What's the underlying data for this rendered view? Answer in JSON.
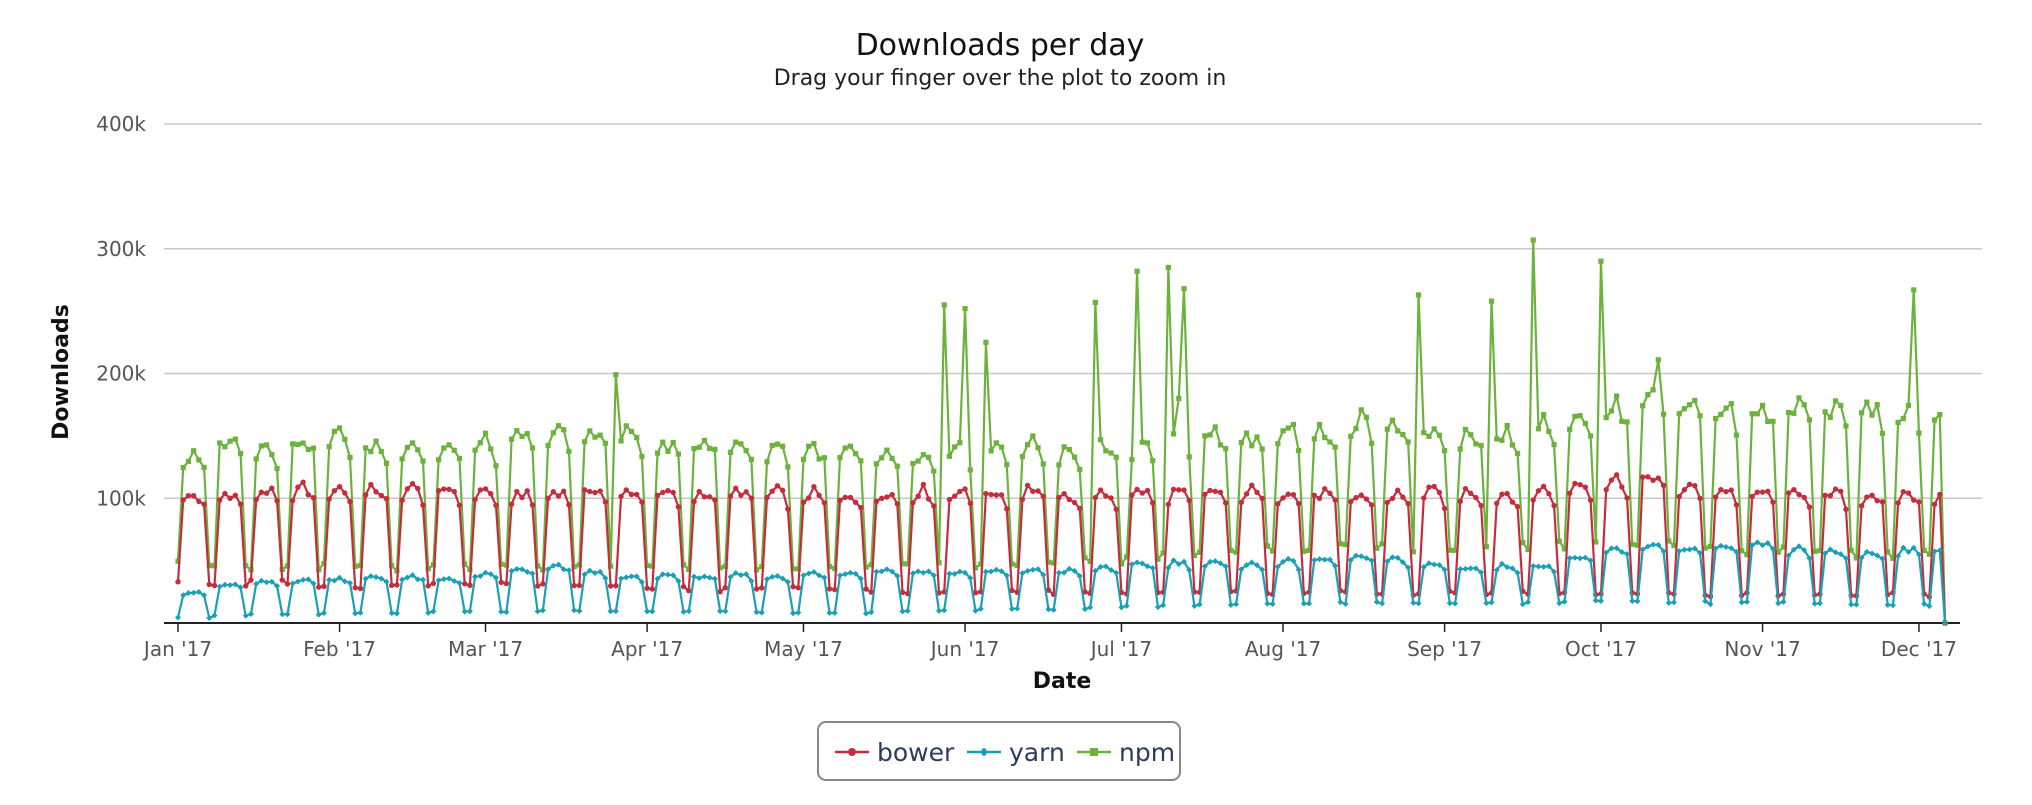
{
  "chart_data": {
    "type": "line",
    "title": "Downloads per day",
    "subtitle": "Drag your finger over the plot to zoom in",
    "xlabel": "Date",
    "ylabel": "Downloads",
    "x_start": "2017-01-01",
    "x_end": "2017-12-06",
    "x_ticks": [
      "Jan '17",
      "Feb '17",
      "Mar '17",
      "Apr '17",
      "May '17",
      "Jun '17",
      "Jul '17",
      "Aug '17",
      "Sep '17",
      "Oct '17",
      "Nov '17",
      "Dec '17"
    ],
    "y_ticks": [
      "400k",
      "300k",
      "200k",
      "100k"
    ],
    "ylim": [
      0,
      400000
    ],
    "grid": true,
    "legend": "bottom-center",
    "series": [
      {
        "name": "bower",
        "color": "#c42e3c",
        "marker": "circle",
        "weekday_level": [
          100000,
          102000,
          104000,
          106000,
          106000,
          105000,
          106000,
          106000,
          104000,
          102000,
          104000,
          106000,
          104000,
          102000,
          103000,
          104000,
          103000,
          102000,
          101000,
          103000,
          104000,
          104000,
          103000,
          106000,
          100000,
          101000,
          104000,
          103000,
          104000,
          104000,
          103000,
          102000,
          100000,
          101000,
          103000,
          104000,
          102000,
          105000,
          110000,
          113000,
          116000,
          107000,
          105000,
          103000,
          104000,
          102000,
          101000,
          102000,
          102000,
          103000,
          102000
        ],
        "weekend_level": [
          30000,
          30000,
          33000,
          30000,
          28000,
          29000,
          30000,
          30000,
          31000,
          30000,
          31000,
          29000,
          29000,
          28000,
          26000,
          27000,
          28000,
          27000,
          26000,
          25000,
          24000,
          25000,
          26000,
          25000,
          24000,
          25000,
          24000,
          24000,
          24000,
          25000,
          24000,
          25000,
          24000,
          23000,
          24000,
          24000,
          24000,
          23000,
          24000,
          24000,
          23000,
          23000,
          22000,
          23000,
          22000,
          22000,
          22000,
          23000,
          22000,
          22000,
          22000
        ]
      },
      {
        "name": "yarn",
        "color": "#1a9fb5",
        "marker": "diamond",
        "weekday_level": [
          24000,
          30000,
          32000,
          34000,
          35000,
          36000,
          36000,
          35000,
          38000,
          42000,
          44000,
          40000,
          36000,
          38000,
          37000,
          38000,
          37000,
          39000,
          40000,
          42000,
          41000,
          40000,
          41000,
          42000,
          41000,
          44000,
          47000,
          48000,
          47000,
          46000,
          48000,
          50000,
          52000,
          50000,
          46000,
          44000,
          45000,
          46000,
          52000,
          58000,
          62000,
          58000,
          60000,
          62000,
          58000,
          56000,
          55000,
          58000,
          60000,
          60000,
          61000
        ],
        "weekend_level": [
          4000,
          6000,
          7000,
          7000,
          8000,
          8000,
          8000,
          9000,
          9000,
          9000,
          10000,
          10000,
          9000,
          9000,
          9000,
          9000,
          8000,
          8000,
          8000,
          9000,
          10000,
          10000,
          11000,
          11000,
          11000,
          12000,
          13000,
          14000,
          15000,
          16000,
          16000,
          16000,
          16000,
          16000,
          16000,
          16000,
          16000,
          16000,
          17000,
          17000,
          17000,
          17000,
          16000,
          16000,
          16000,
          15000,
          15000,
          15000,
          14000,
          14000,
          14000
        ]
      },
      {
        "name": "npm",
        "color": "#6cb33e",
        "marker": "square",
        "weekday_level": [
          130000,
          145000,
          140000,
          145000,
          148000,
          140000,
          142000,
          138000,
          142000,
          148000,
          150000,
          152000,
          150000,
          140000,
          145000,
          142000,
          140000,
          138000,
          135000,
          132000,
          130000,
          135000,
          138000,
          140000,
          135000,
          140000,
          142000,
          145000,
          150000,
          145000,
          155000,
          150000,
          160000,
          155000,
          152000,
          150000,
          148000,
          160000,
          165000,
          170000,
          185000,
          175000,
          170000,
          168000,
          172000,
          168000,
          170000,
          168000,
          165000,
          160000,
          160000
        ],
        "weekend_level": [
          45000,
          48000,
          45000,
          45000,
          46000,
          45000,
          44000,
          46000,
          45000,
          44000,
          45000,
          45000,
          44000,
          46000,
          45000,
          44000,
          43000,
          44000,
          43000,
          45000,
          46000,
          47000,
          48000,
          48000,
          50000,
          50000,
          52000,
          55000,
          58000,
          60000,
          60000,
          60000,
          60000,
          60000,
          61000,
          61000,
          62000,
          62000,
          63000,
          64000,
          65000,
          62000,
          60000,
          58000,
          58000,
          56000,
          55000,
          55000,
          54000,
          54000,
          54000
        ],
        "spikes": [
          {
            "date": "2017-03-26",
            "value": 199000
          },
          {
            "date": "2017-05-28",
            "value": 255000
          },
          {
            "date": "2017-06-01",
            "value": 252000
          },
          {
            "date": "2017-06-05",
            "value": 225000
          },
          {
            "date": "2017-06-26",
            "value": 257000
          },
          {
            "date": "2017-07-04",
            "value": 282000
          },
          {
            "date": "2017-07-10",
            "value": 285000
          },
          {
            "date": "2017-07-12",
            "value": 180000
          },
          {
            "date": "2017-07-13",
            "value": 268000
          },
          {
            "date": "2017-08-27",
            "value": 263000
          },
          {
            "date": "2017-09-10",
            "value": 258000
          },
          {
            "date": "2017-09-18",
            "value": 307000
          },
          {
            "date": "2017-10-01",
            "value": 290000
          },
          {
            "date": "2017-10-12",
            "value": 211000
          },
          {
            "date": "2017-11-30",
            "value": 267000
          }
        ]
      }
    ]
  }
}
